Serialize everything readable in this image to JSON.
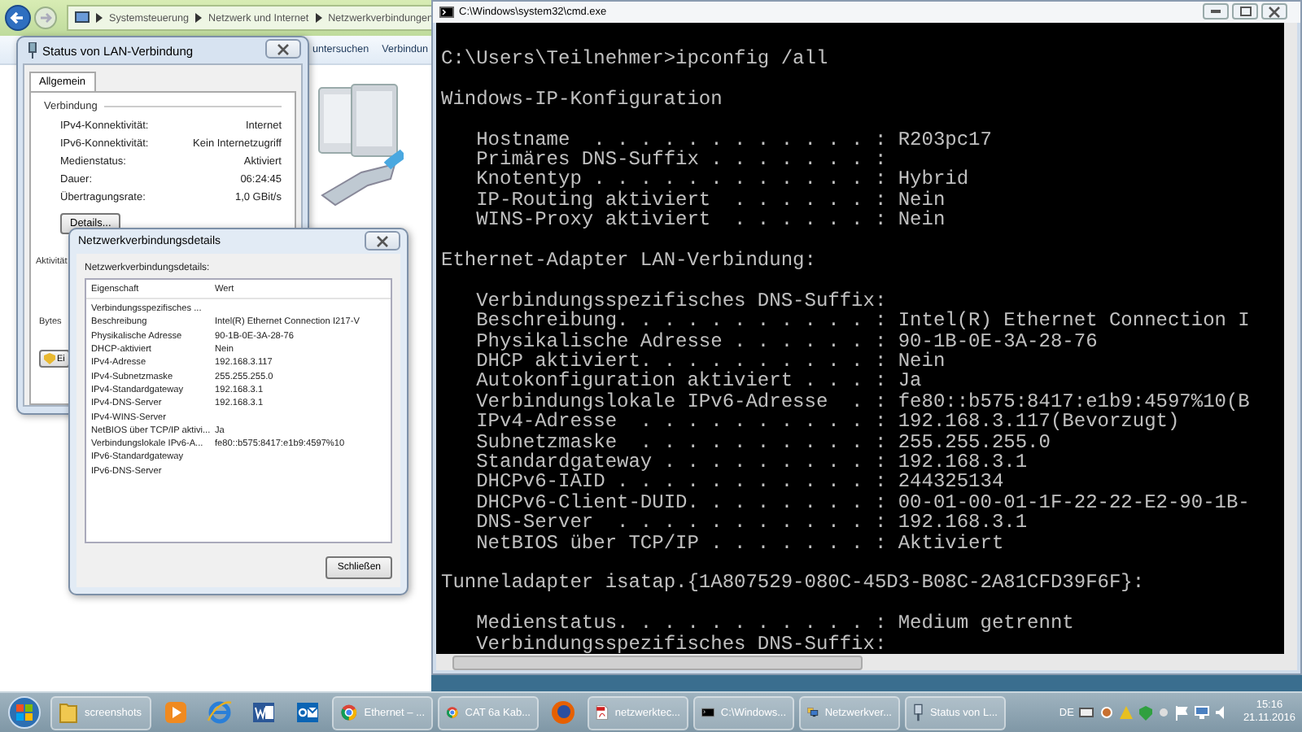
{
  "explorer": {
    "breadcrumb": [
      "Systemsteuerung",
      "Netzwerk und Internet",
      "Netzwerkverbindungen"
    ],
    "toolbar": [
      "untersuchen",
      "Verbindun"
    ]
  },
  "status_dialog": {
    "title": "Status von LAN-Verbindung",
    "tabs": [
      {
        "label": "Allgemein",
        "selected": true
      }
    ],
    "group": "Verbindung",
    "rows": [
      {
        "label": "IPv4-Konnektivität:",
        "value": "Internet"
      },
      {
        "label": "IPv6-Konnektivität:",
        "value": "Kein Internetzugriff"
      },
      {
        "label": "Medienstatus:",
        "value": "Aktiviert"
      },
      {
        "label": "Dauer:",
        "value": "06:24:45"
      },
      {
        "label": "Übertragungsrate:",
        "value": "1,0 GBit/s"
      }
    ],
    "details_button": "Details...",
    "activity_label": "Aktivität",
    "bytes_label": "Bytes",
    "partial_button": "Ei"
  },
  "details_dialog": {
    "title": "Netzwerkverbindungsdetails",
    "caption": "Netzwerkverbindungsdetails:",
    "columns": [
      "Eigenschaft",
      "Wert"
    ],
    "rows": [
      {
        "property": "Verbindungsspezifisches ..."
      },
      {
        "property": "Beschreibung",
        "value": "Intel(R) Ethernet Connection I217-V"
      },
      {
        "property": "Physikalische Adresse",
        "value": "90-1B-0E-3A-28-76"
      },
      {
        "property": "DHCP-aktiviert",
        "value": "Nein"
      },
      {
        "property": "IPv4-Adresse",
        "value": "192.168.3.117"
      },
      {
        "property": "IPv4-Subnetzmaske",
        "value": "255.255.255.0"
      },
      {
        "property": "IPv4-Standardgateway",
        "value": "192.168.3.1"
      },
      {
        "property": "IPv4-DNS-Server",
        "value": "192.168.3.1"
      },
      {
        "property": "IPv4-WINS-Server"
      },
      {
        "property": "NetBIOS über TCP/IP aktivi...",
        "value": "Ja"
      },
      {
        "property": "Verbindungslokale IPv6-A...",
        "value": "fe80::b575:8417:e1b9:4597%10"
      },
      {
        "property": "IPv6-Standardgateway"
      },
      {
        "property": "IPv6-DNS-Server"
      }
    ],
    "close_button": "Schließen"
  },
  "console": {
    "title": "C:\\Windows\\system32\\cmd.exe",
    "blocks": [
      [
        "C:\\Users\\Teilnehmer>ipconfig /all"
      ],
      [
        "Windows-IP-Konfiguration"
      ],
      [
        "   Hostname  . . . . . . . . . . . . : R203pc17",
        "   Primäres DNS-Suffix . . . . . . . :",
        "   Knotentyp . . . . . . . . . . . . : Hybrid",
        "   IP-Routing aktiviert  . . . . . . : Nein",
        "   WINS-Proxy aktiviert  . . . . . . : Nein"
      ],
      [
        "Ethernet-Adapter LAN-Verbindung:"
      ],
      [
        "   Verbindungsspezifisches DNS-Suffix:",
        "   Beschreibung. . . . . . . . . . . : Intel(R) Ethernet Connection I",
        "   Physikalische Adresse . . . . . . : 90-1B-0E-3A-28-76",
        "   DHCP aktiviert. . . . . . . . . . : Nein",
        "   Autokonfiguration aktiviert . . . : Ja",
        "   Verbindungslokale IPv6-Adresse  . : fe80::b575:8417:e1b9:4597%10(B",
        "   IPv4-Adresse  . . . . . . . . . . : 192.168.3.117(Bevorzugt)",
        "   Subnetzmaske  . . . . . . . . . . : 255.255.255.0",
        "   Standardgateway . . . . . . . . . : 192.168.3.1",
        "   DHCPv6-IAID . . . . . . . . . . . : 244325134",
        "   DHCPv6-Client-DUID. . . . . . . . : 00-01-00-01-1F-22-22-E2-90-1B-",
        "   DNS-Server  . . . . . . . . . . . : 192.168.3.1",
        "   NetBIOS über TCP/IP . . . . . . . : Aktiviert"
      ],
      [
        "Tunneladapter isatap.{1A807529-080C-45D3-B08C-2A81CFD39F6F}:"
      ],
      [
        "   Medienstatus. . . . . . . . . . . : Medium getrennt",
        "   Verbindungsspezifisches DNS-Suffix:"
      ]
    ]
  },
  "taskbar": {
    "items": [
      {
        "kind": "folder",
        "label": "screenshots"
      },
      {
        "kind": "media"
      },
      {
        "kind": "globe"
      },
      {
        "kind": "word"
      },
      {
        "kind": "mail"
      },
      {
        "kind": "chrome",
        "label": "Ethernet – ..."
      },
      {
        "kind": "chrome",
        "label": "CAT 6a Kab..."
      },
      {
        "kind": "firefox"
      },
      {
        "kind": "pdf",
        "label": "netzwerktec..."
      },
      {
        "kind": "terminal",
        "label": "C:\\Windows..."
      },
      {
        "kind": "network",
        "label": "Netzwerkver..."
      },
      {
        "kind": "dialog",
        "label": "Status von L..."
      }
    ],
    "language": "DE",
    "time": "15:16",
    "date": "21.11.2016"
  }
}
